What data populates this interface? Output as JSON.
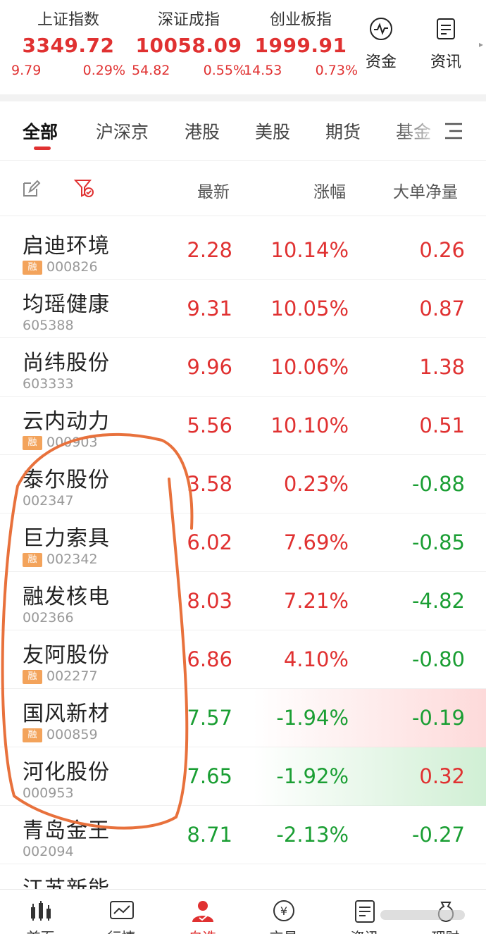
{
  "indices": [
    {
      "name": "上证指数",
      "value": "3349.72",
      "change": "9.79",
      "percent": "0.29%"
    },
    {
      "name": "深证成指",
      "value": "10058.09",
      "change": "54.82",
      "percent": "0.55%"
    },
    {
      "name": "创业板指",
      "value": "1999.91",
      "change": "14.53",
      "percent": "0.73%"
    }
  ],
  "tools": {
    "fund": "资金",
    "news": "资讯"
  },
  "tabs": [
    "全部",
    "沪深京",
    "港股",
    "美股",
    "期货",
    "基金"
  ],
  "active_tab": "全部",
  "columns": {
    "latest": "最新",
    "change": "涨幅",
    "net_volume": "大单净量"
  },
  "margin_badge": "融",
  "stocks": [
    {
      "name": "启迪环境",
      "code": "000826",
      "margin": true,
      "price": "2.28",
      "pct": "10.14%",
      "net": "0.26",
      "price_color": "red",
      "pct_color": "red",
      "net_color": "red",
      "bg": ""
    },
    {
      "name": "均瑶健康",
      "code": "605388",
      "margin": false,
      "price": "9.31",
      "pct": "10.05%",
      "net": "0.87",
      "price_color": "red",
      "pct_color": "red",
      "net_color": "red",
      "bg": ""
    },
    {
      "name": "尚纬股份",
      "code": "603333",
      "margin": false,
      "price": "9.96",
      "pct": "10.06%",
      "net": "1.38",
      "price_color": "red",
      "pct_color": "red",
      "net_color": "red",
      "bg": ""
    },
    {
      "name": "云内动力",
      "code": "000903",
      "margin": true,
      "price": "5.56",
      "pct": "10.10%",
      "net": "0.51",
      "price_color": "red",
      "pct_color": "red",
      "net_color": "red",
      "bg": ""
    },
    {
      "name": "泰尔股份",
      "code": "002347",
      "margin": false,
      "price": "3.58",
      "pct": "0.23%",
      "net": "-0.88",
      "price_color": "red",
      "pct_color": "red",
      "net_color": "green",
      "bg": ""
    },
    {
      "name": "巨力索具",
      "code": "002342",
      "margin": true,
      "price": "6.02",
      "pct": "7.69%",
      "net": "-0.85",
      "price_color": "red",
      "pct_color": "red",
      "net_color": "green",
      "bg": ""
    },
    {
      "name": "融发核电",
      "code": "002366",
      "margin": false,
      "price": "8.03",
      "pct": "7.21%",
      "net": "-4.82",
      "price_color": "red",
      "pct_color": "red",
      "net_color": "green",
      "bg": ""
    },
    {
      "name": "友阿股份",
      "code": "002277",
      "margin": true,
      "price": "6.86",
      "pct": "4.10%",
      "net": "-0.80",
      "price_color": "red",
      "pct_color": "red",
      "net_color": "green",
      "bg": ""
    },
    {
      "name": "国风新材",
      "code": "000859",
      "margin": true,
      "price": "7.57",
      "pct": "-1.94%",
      "net": "-0.19",
      "price_color": "green",
      "pct_color": "green",
      "net_color": "green",
      "bg": "red"
    },
    {
      "name": "河化股份",
      "code": "000953",
      "margin": false,
      "price": "7.65",
      "pct": "-1.92%",
      "net": "0.32",
      "price_color": "green",
      "pct_color": "green",
      "net_color": "red",
      "bg": "green"
    },
    {
      "name": "青岛金王",
      "code": "002094",
      "margin": false,
      "price": "8.71",
      "pct": "-2.13%",
      "net": "-0.27",
      "price_color": "green",
      "pct_color": "green",
      "net_color": "green",
      "bg": ""
    },
    {
      "name": "江苏新能",
      "code": "",
      "margin": false,
      "price": "",
      "pct": "",
      "net": "",
      "price_color": "red",
      "pct_color": "red",
      "net_color": "red",
      "bg": ""
    }
  ],
  "bottom_nav": [
    {
      "label": "首页",
      "icon": "home-icon"
    },
    {
      "label": "行情",
      "icon": "market-icon"
    },
    {
      "label": "自选",
      "icon": "watchlist-icon"
    },
    {
      "label": "交易",
      "icon": "trade-icon"
    },
    {
      "label": "资讯",
      "icon": "news-icon"
    },
    {
      "label": "理财",
      "icon": "wealth-icon"
    }
  ],
  "active_nav": "自选",
  "colors": {
    "up": "#e03131",
    "down": "#1a9e33",
    "annotation": "#e8713c"
  }
}
